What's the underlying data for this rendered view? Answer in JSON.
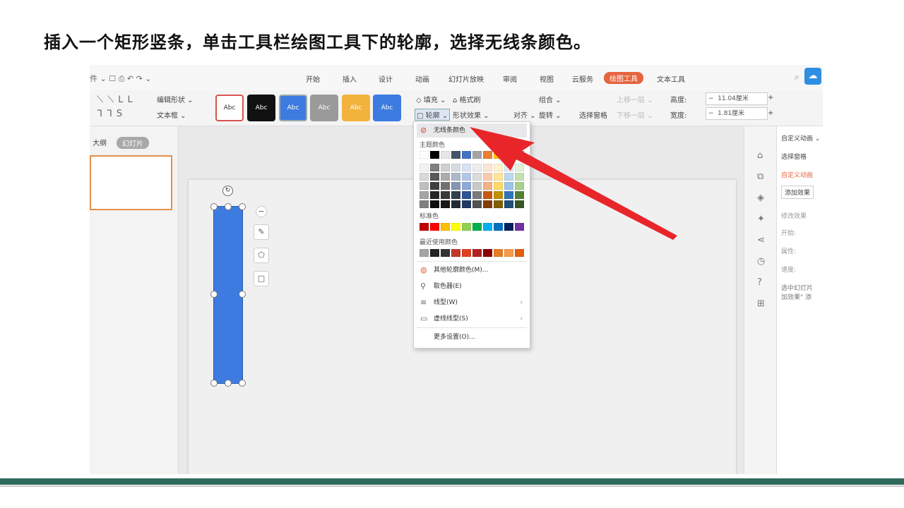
{
  "caption": "插入一个矩形竖条，单击工具栏绘图工具下的轮廓，选择无线条颜色。",
  "colors": {
    "accent": "#e6643e",
    "shape": "#3d7be0",
    "bar": "#2e6b5c",
    "arrow": "#e8262a"
  },
  "titlebar": {
    "quick_access": "件 ⌄   ☐  ⎙  ↶  ↷  ⌄",
    "tabs": [
      "开始",
      "插入",
      "设计",
      "动画",
      "幻灯片放映",
      "审阅",
      "视图",
      "云服务",
      "绘图工具",
      "文本工具"
    ],
    "active_tab": "绘图工具"
  },
  "ribbon": {
    "edit_shape": "编辑形状 ⌄",
    "text_box": "文本框 ⌄",
    "style_swatches": [
      {
        "label": "Abc",
        "bg": "#ffffff",
        "fg": "#333",
        "border": "#d9534f"
      },
      {
        "label": "Abc",
        "bg": "#111111",
        "fg": "#fff",
        "border": "#111"
      },
      {
        "label": "Abc",
        "bg": "#3d7be0",
        "fg": "#fff",
        "border": "#9aa"
      },
      {
        "label": "Abc",
        "bg": "#9a9a9a",
        "fg": "#fff",
        "border": "#9a9a9a"
      },
      {
        "label": "Abc",
        "bg": "#f2b33d",
        "fg": "#fff",
        "border": "#f2b33d"
      },
      {
        "label": "Abc",
        "bg": "#3d7be0",
        "fg": "#fff",
        "border": "#3d7be0"
      }
    ],
    "fill": "填充 ⌄",
    "format_painter": "格式刷",
    "outline": "轮廓 ⌄",
    "shape_effects": "形状效果 ⌄",
    "align": "对齐 ⌄",
    "group": "组合 ⌄",
    "rotate": "旋转 ⌄",
    "selection_pane": "选择窗格",
    "bring_forward": "上移一层 ⌄",
    "send_backward": "下移一层 ⌄",
    "height_label": "高度:",
    "height_value": "11.04厘米",
    "width_label": "宽度:",
    "width_value": "1.81厘米"
  },
  "left_pane": {
    "outline_tab": "大纲",
    "slides_tab": "幻灯片"
  },
  "right_pane": {
    "title": "自定义动画 ⌄",
    "select_pane": "选择窗格",
    "custom_anim": "自定义动画",
    "add_effect": "添加效果",
    "modify": "修改效果",
    "start": "开始:",
    "property": "属性:",
    "speed": "速度:",
    "note": "选中幻灯片 加效果\" 添"
  },
  "menu": {
    "no_line": "无线条颜色",
    "theme_colors": "主题颜色",
    "standard_colors": "标准色",
    "recent_colors": "最近使用颜色",
    "more_colors": "其他轮廓颜色(M)...",
    "eyedropper": "取色器(E)",
    "line_type": "线型(W)",
    "dash_type": "虚线线型(S)",
    "more_settings": "更多设置(O)...",
    "theme_top": [
      "#ffffff",
      "#000000",
      "#e7e6e6",
      "#44546a",
      "#4472c4",
      "#a5a5a5",
      "#ed7d31",
      "#ffc000",
      "#5b9bd5",
      "#70ad47"
    ],
    "theme_shades": [
      [
        "#f2f2f2",
        "#808080",
        "#d0cece",
        "#d6dce4",
        "#d9e2f3",
        "#ededed",
        "#fbe5d5",
        "#fff2cc",
        "#deebf6",
        "#e2efd9"
      ],
      [
        "#d8d8d8",
        "#595959",
        "#aeabab",
        "#adb9ca",
        "#b4c6e7",
        "#dbdbdb",
        "#f7cbac",
        "#fee599",
        "#bdd7ee",
        "#c5e0b3"
      ],
      [
        "#bfbfbf",
        "#3f3f3f",
        "#757070",
        "#8496b0",
        "#8eaadb",
        "#c9c9c9",
        "#f4b183",
        "#ffd965",
        "#9cc3e5",
        "#a8d08d"
      ],
      [
        "#a5a5a5",
        "#262626",
        "#3a3838",
        "#323f4f",
        "#2f5496",
        "#7b7b7b",
        "#c45911",
        "#bf9000",
        "#2e75b5",
        "#538135"
      ],
      [
        "#7f7f7f",
        "#0c0c0c",
        "#171616",
        "#222a35",
        "#1f3864",
        "#525252",
        "#833c0b",
        "#7f6000",
        "#1e4e79",
        "#375623"
      ]
    ],
    "standard": [
      "#c00000",
      "#ff0000",
      "#ffc000",
      "#ffff00",
      "#92d050",
      "#00b050",
      "#00b0f0",
      "#0070c0",
      "#002060",
      "#7030a0"
    ],
    "recent": [
      "#a5a5a5",
      "#222222",
      "#333333",
      "#c0392b",
      "#e04020",
      "#b22222",
      "#8b0000",
      "#e67e22",
      "#f39c4b",
      "#e06010"
    ]
  }
}
